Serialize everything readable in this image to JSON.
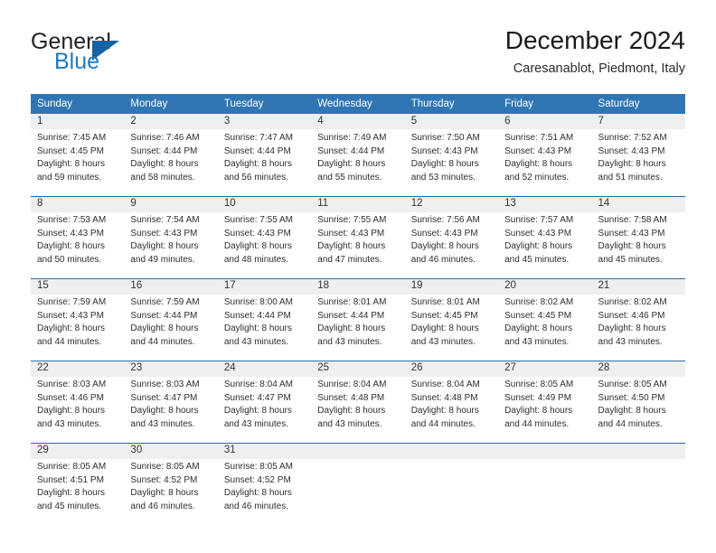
{
  "brand": {
    "name_top": "General",
    "name_bottom": "Blue",
    "accent_color": "#1f7ac0",
    "triangle_color": "#1464a5"
  },
  "header": {
    "title": "December 2024",
    "location": "Caresanablot, Piedmont, Italy"
  },
  "theme": {
    "header_bg": "#3076b5",
    "header_text": "#ffffff",
    "date_band_bg": "#efefef",
    "row_line": "#2d6ca8",
    "body_text": "#2e2e2e"
  },
  "weekdays": [
    "Sunday",
    "Monday",
    "Tuesday",
    "Wednesday",
    "Thursday",
    "Friday",
    "Saturday"
  ],
  "weeks": [
    {
      "days": [
        {
          "num": "1",
          "sunrise": "Sunrise: 7:45 AM",
          "sunset": "Sunset: 4:45 PM",
          "daylight1": "Daylight: 8 hours",
          "daylight2": "and 59 minutes."
        },
        {
          "num": "2",
          "sunrise": "Sunrise: 7:46 AM",
          "sunset": "Sunset: 4:44 PM",
          "daylight1": "Daylight: 8 hours",
          "daylight2": "and 58 minutes."
        },
        {
          "num": "3",
          "sunrise": "Sunrise: 7:47 AM",
          "sunset": "Sunset: 4:44 PM",
          "daylight1": "Daylight: 8 hours",
          "daylight2": "and 56 minutes."
        },
        {
          "num": "4",
          "sunrise": "Sunrise: 7:49 AM",
          "sunset": "Sunset: 4:44 PM",
          "daylight1": "Daylight: 8 hours",
          "daylight2": "and 55 minutes."
        },
        {
          "num": "5",
          "sunrise": "Sunrise: 7:50 AM",
          "sunset": "Sunset: 4:43 PM",
          "daylight1": "Daylight: 8 hours",
          "daylight2": "and 53 minutes."
        },
        {
          "num": "6",
          "sunrise": "Sunrise: 7:51 AM",
          "sunset": "Sunset: 4:43 PM",
          "daylight1": "Daylight: 8 hours",
          "daylight2": "and 52 minutes."
        },
        {
          "num": "7",
          "sunrise": "Sunrise: 7:52 AM",
          "sunset": "Sunset: 4:43 PM",
          "daylight1": "Daylight: 8 hours",
          "daylight2": "and 51 minutes."
        }
      ]
    },
    {
      "days": [
        {
          "num": "8",
          "sunrise": "Sunrise: 7:53 AM",
          "sunset": "Sunset: 4:43 PM",
          "daylight1": "Daylight: 8 hours",
          "daylight2": "and 50 minutes."
        },
        {
          "num": "9",
          "sunrise": "Sunrise: 7:54 AM",
          "sunset": "Sunset: 4:43 PM",
          "daylight1": "Daylight: 8 hours",
          "daylight2": "and 49 minutes."
        },
        {
          "num": "10",
          "sunrise": "Sunrise: 7:55 AM",
          "sunset": "Sunset: 4:43 PM",
          "daylight1": "Daylight: 8 hours",
          "daylight2": "and 48 minutes."
        },
        {
          "num": "11",
          "sunrise": "Sunrise: 7:55 AM",
          "sunset": "Sunset: 4:43 PM",
          "daylight1": "Daylight: 8 hours",
          "daylight2": "and 47 minutes."
        },
        {
          "num": "12",
          "sunrise": "Sunrise: 7:56 AM",
          "sunset": "Sunset: 4:43 PM",
          "daylight1": "Daylight: 8 hours",
          "daylight2": "and 46 minutes."
        },
        {
          "num": "13",
          "sunrise": "Sunrise: 7:57 AM",
          "sunset": "Sunset: 4:43 PM",
          "daylight1": "Daylight: 8 hours",
          "daylight2": "and 45 minutes."
        },
        {
          "num": "14",
          "sunrise": "Sunrise: 7:58 AM",
          "sunset": "Sunset: 4:43 PM",
          "daylight1": "Daylight: 8 hours",
          "daylight2": "and 45 minutes."
        }
      ]
    },
    {
      "days": [
        {
          "num": "15",
          "sunrise": "Sunrise: 7:59 AM",
          "sunset": "Sunset: 4:43 PM",
          "daylight1": "Daylight: 8 hours",
          "daylight2": "and 44 minutes."
        },
        {
          "num": "16",
          "sunrise": "Sunrise: 7:59 AM",
          "sunset": "Sunset: 4:44 PM",
          "daylight1": "Daylight: 8 hours",
          "daylight2": "and 44 minutes."
        },
        {
          "num": "17",
          "sunrise": "Sunrise: 8:00 AM",
          "sunset": "Sunset: 4:44 PM",
          "daylight1": "Daylight: 8 hours",
          "daylight2": "and 43 minutes."
        },
        {
          "num": "18",
          "sunrise": "Sunrise: 8:01 AM",
          "sunset": "Sunset: 4:44 PM",
          "daylight1": "Daylight: 8 hours",
          "daylight2": "and 43 minutes."
        },
        {
          "num": "19",
          "sunrise": "Sunrise: 8:01 AM",
          "sunset": "Sunset: 4:45 PM",
          "daylight1": "Daylight: 8 hours",
          "daylight2": "and 43 minutes."
        },
        {
          "num": "20",
          "sunrise": "Sunrise: 8:02 AM",
          "sunset": "Sunset: 4:45 PM",
          "daylight1": "Daylight: 8 hours",
          "daylight2": "and 43 minutes."
        },
        {
          "num": "21",
          "sunrise": "Sunrise: 8:02 AM",
          "sunset": "Sunset: 4:46 PM",
          "daylight1": "Daylight: 8 hours",
          "daylight2": "and 43 minutes."
        }
      ]
    },
    {
      "days": [
        {
          "num": "22",
          "sunrise": "Sunrise: 8:03 AM",
          "sunset": "Sunset: 4:46 PM",
          "daylight1": "Daylight: 8 hours",
          "daylight2": "and 43 minutes."
        },
        {
          "num": "23",
          "sunrise": "Sunrise: 8:03 AM",
          "sunset": "Sunset: 4:47 PM",
          "daylight1": "Daylight: 8 hours",
          "daylight2": "and 43 minutes."
        },
        {
          "num": "24",
          "sunrise": "Sunrise: 8:04 AM",
          "sunset": "Sunset: 4:47 PM",
          "daylight1": "Daylight: 8 hours",
          "daylight2": "and 43 minutes."
        },
        {
          "num": "25",
          "sunrise": "Sunrise: 8:04 AM",
          "sunset": "Sunset: 4:48 PM",
          "daylight1": "Daylight: 8 hours",
          "daylight2": "and 43 minutes."
        },
        {
          "num": "26",
          "sunrise": "Sunrise: 8:04 AM",
          "sunset": "Sunset: 4:48 PM",
          "daylight1": "Daylight: 8 hours",
          "daylight2": "and 44 minutes."
        },
        {
          "num": "27",
          "sunrise": "Sunrise: 8:05 AM",
          "sunset": "Sunset: 4:49 PM",
          "daylight1": "Daylight: 8 hours",
          "daylight2": "and 44 minutes."
        },
        {
          "num": "28",
          "sunrise": "Sunrise: 8:05 AM",
          "sunset": "Sunset: 4:50 PM",
          "daylight1": "Daylight: 8 hours",
          "daylight2": "and 44 minutes."
        }
      ]
    },
    {
      "days": [
        {
          "num": "29",
          "sunrise": "Sunrise: 8:05 AM",
          "sunset": "Sunset: 4:51 PM",
          "daylight1": "Daylight: 8 hours",
          "daylight2": "and 45 minutes."
        },
        {
          "num": "30",
          "sunrise": "Sunrise: 8:05 AM",
          "sunset": "Sunset: 4:52 PM",
          "daylight1": "Daylight: 8 hours",
          "daylight2": "and 46 minutes."
        },
        {
          "num": "31",
          "sunrise": "Sunrise: 8:05 AM",
          "sunset": "Sunset: 4:52 PM",
          "daylight1": "Daylight: 8 hours",
          "daylight2": "and 46 minutes."
        },
        {
          "num": "",
          "sunrise": "",
          "sunset": "",
          "daylight1": "",
          "daylight2": ""
        },
        {
          "num": "",
          "sunrise": "",
          "sunset": "",
          "daylight1": "",
          "daylight2": ""
        },
        {
          "num": "",
          "sunrise": "",
          "sunset": "",
          "daylight1": "",
          "daylight2": ""
        },
        {
          "num": "",
          "sunrise": "",
          "sunset": "",
          "daylight1": "",
          "daylight2": ""
        }
      ]
    }
  ]
}
